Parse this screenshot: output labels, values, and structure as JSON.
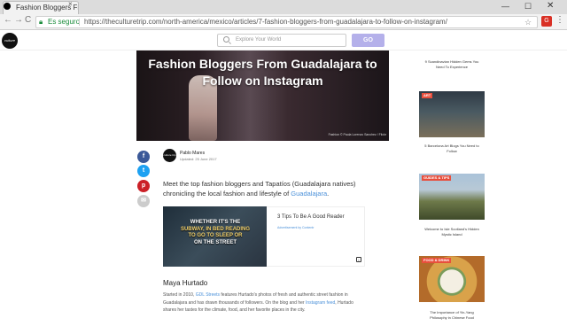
{
  "browser": {
    "tab_title": "Fashion Bloggers From G",
    "tab_close": "×",
    "secure_label": "Es seguro",
    "url": "https://theculturetrip.com/north-america/mexico/articles/7-fashion-bloggers-from-guadalajara-to-follow-on-instagram/",
    "extension_badge": "G",
    "window_min": "—",
    "window_max": "☐",
    "window_close": "✕",
    "back_glyph": "←",
    "forward_glyph": "→",
    "reload_glyph": "C",
    "menu_glyph": "⋮",
    "star_glyph": "☆"
  },
  "site": {
    "logo_text": "culture trip",
    "search_placeholder": "Explore Your World",
    "go_label": "GO"
  },
  "article": {
    "title": "Fashion Bloggers From Guadalajara to Follow on Instagram",
    "hero_credit": "Fashion © Paula Lorenzo Sanchez / Flickr",
    "author_name": "Pablo Mares",
    "updated": "Updated: 25 June 2017",
    "lead_text": "Meet the top fashion bloggers and Tapatíos (Guadalajara natives) chronicling the local fashion and lifestyle of ",
    "lead_link": "Guadalajara",
    "lead_end": ".",
    "section_heading": "Maya Hurtado",
    "para_1": "Started in 2010, ",
    "para_link1": "GDL Streets",
    "para_2": " features Hurtado's photos of fresh and authentic street fashion in Guadalajara and has drawn thousands of followers. On the blog and her ",
    "para_link2": "Instagram feed",
    "para_3": ", Hurtado shares her tastes for the climate, food, and her favorite places in the city."
  },
  "share": {
    "facebook": "f",
    "twitter": "t",
    "pinterest": "p",
    "email": "✉"
  },
  "ad": {
    "image_line1": "WHETHER IT'S THE",
    "image_line2": "SUBWAY, IN BED READING",
    "image_line3": "TO GO TO SLEEP OR",
    "image_line4": "ON THE STREET",
    "title": "3 Tips To Be A Good Reader",
    "sponsor": "Advertisement by Contentr",
    "badge": "i"
  },
  "sidebar": [
    {
      "category": "",
      "title": "9 Scandinavian Hidden Gems You Need To Experience"
    },
    {
      "category": "ART",
      "title": "5 Barcelona Art Blogs You Need to Follow"
    },
    {
      "category": "GUIDES & TIPS",
      "title": "Welcome to Isle Scotland's Hidden Mystic Island"
    },
    {
      "category": "FOOD & DRINK",
      "title": "The Importance of Yin-Yang Philosophy in Chinese Food"
    }
  ]
}
